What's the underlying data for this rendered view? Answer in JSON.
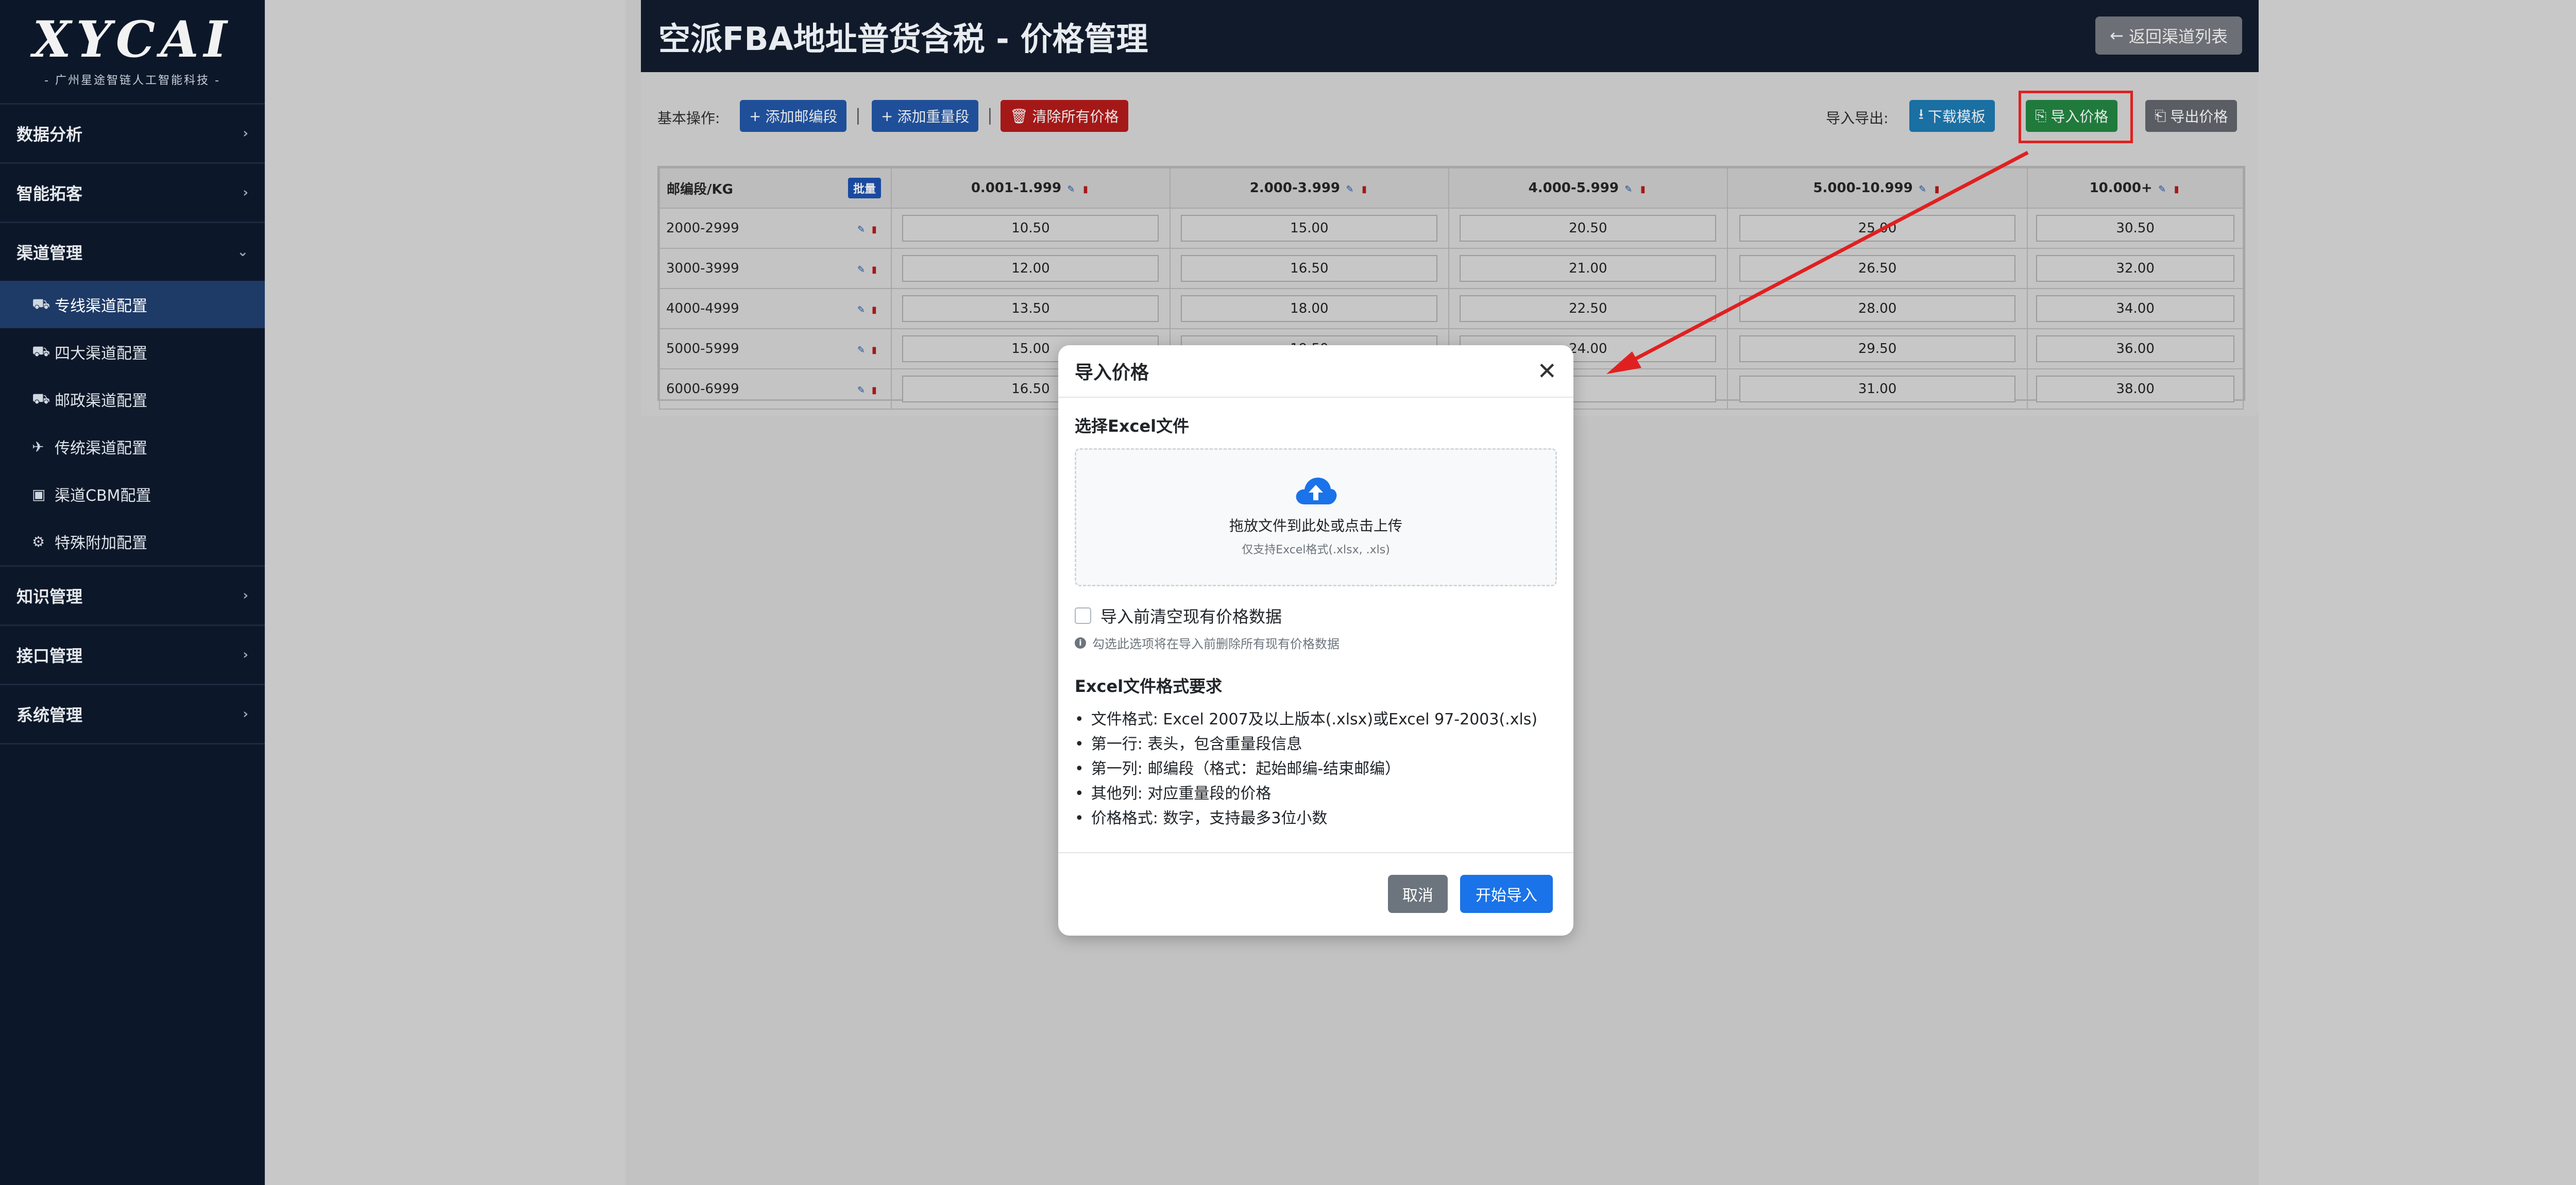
{
  "sidebar": {
    "logo_text": "XYCAI",
    "logo_sub": "- 广州星途智链人工智能科技 -",
    "items": [
      {
        "label": "数据分析"
      },
      {
        "label": "智能拓客"
      },
      {
        "label": "渠道管理"
      },
      {
        "label": "知识管理"
      },
      {
        "label": "接口管理"
      },
      {
        "label": "系统管理"
      }
    ],
    "submenu": [
      {
        "label": "专线渠道配置",
        "icon": "truck-icon"
      },
      {
        "label": "四大渠道配置",
        "icon": "truck-fast-icon"
      },
      {
        "label": "邮政渠道配置",
        "icon": "truck-fast-icon"
      },
      {
        "label": "传统渠道配置",
        "icon": "plane-icon"
      },
      {
        "label": "渠道CBM配置",
        "icon": "box-icon"
      },
      {
        "label": "特殊附加配置",
        "icon": "gear-icon"
      }
    ]
  },
  "header": {
    "title": "空派FBA地址普货含税 - 价格管理",
    "back_label": "返回渠道列表"
  },
  "toolbar": {
    "basic_ops_label": "基本操作:",
    "add_zip_label": "添加邮编段",
    "add_weight_label": "添加重量段",
    "clear_all_label": "清除所有价格",
    "import_export_label": "导入导出:",
    "download_template_label": "下载模板",
    "import_label": "导入价格",
    "export_label": "导出价格"
  },
  "table": {
    "corner_label": "邮编段/KG",
    "batch_label": "批量",
    "columns": [
      "0.001-1.999",
      "2.000-3.999",
      "4.000-5.999",
      "5.000-10.999",
      "10.000+"
    ],
    "rows": [
      {
        "seg": "2000-2999",
        "prices": [
          "10.50",
          "15.00",
          "20.50",
          "25.00",
          "30.50"
        ]
      },
      {
        "seg": "3000-3999",
        "prices": [
          "12.00",
          "16.50",
          "21.00",
          "26.50",
          "32.00"
        ]
      },
      {
        "seg": "4000-4999",
        "prices": [
          "13.50",
          "18.00",
          "22.50",
          "28.00",
          "34.00"
        ]
      },
      {
        "seg": "5000-5999",
        "prices": [
          "15.00",
          "19.50",
          "24.00",
          "29.50",
          "36.00"
        ]
      },
      {
        "seg": "6000-6999",
        "prices": [
          "16.50",
          "",
          "",
          "31.00",
          "38.00"
        ]
      }
    ]
  },
  "modal": {
    "title": "导入价格",
    "file_label": "选择Excel文件",
    "upload_main": "拖放文件到此处或点击上传",
    "upload_hint": "仅支持Excel格式(.xlsx, .xls)",
    "clear_checkbox_label": "导入前清空现有价格数据",
    "clear_help": "勾选此选项将在导入前删除所有现有价格数据",
    "req_title": "Excel文件格式要求",
    "requirements": [
      "文件格式: Excel 2007及以上版本(.xlsx)或Excel 97-2003(.xls)",
      "第一行: 表头，包含重量段信息",
      "第一列: 邮编段（格式：起始邮编-结束邮编）",
      "其他列: 对应重量段的价格",
      "价格格式: 数字，支持最多3位小数"
    ],
    "cancel_label": "取消",
    "start_label": "开始导入"
  },
  "colors": {
    "sidebar_bg": "#0c1829",
    "active_item": "#1e3a66",
    "primary_blue": "#1a73e8",
    "danger_red": "#a51818",
    "success_green": "#1f7a3c",
    "annotation_red": "#e02020"
  }
}
